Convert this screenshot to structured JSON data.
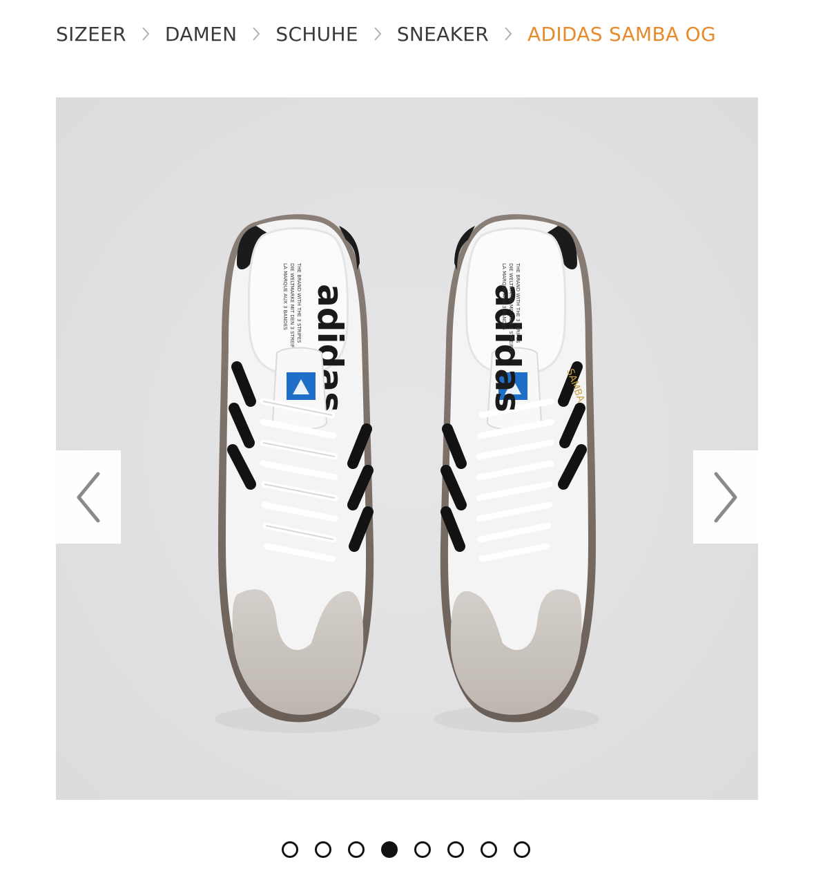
{
  "breadcrumb": {
    "items": [
      "SIZEER",
      "DAMEN",
      "SCHUHE",
      "SNEAKER"
    ],
    "current": "ADIDAS SAMBA OG"
  },
  "gallery": {
    "shoe_logo_text": "adidas",
    "insole_line_1": "THE BRAND WITH THE 3 STRIPES",
    "insole_line_2": "DIE WELTMARKE MIT DEN 3 STREIFEN",
    "insole_line_3": "LA MARQUE AUX 3 BANDES",
    "side_text": "SAMBA",
    "slide_count": 8,
    "active_slide": 4
  },
  "colors": {
    "accent": "#e88a2b",
    "text": "#3a3a3a",
    "image_bg": "#e1e1e3"
  }
}
